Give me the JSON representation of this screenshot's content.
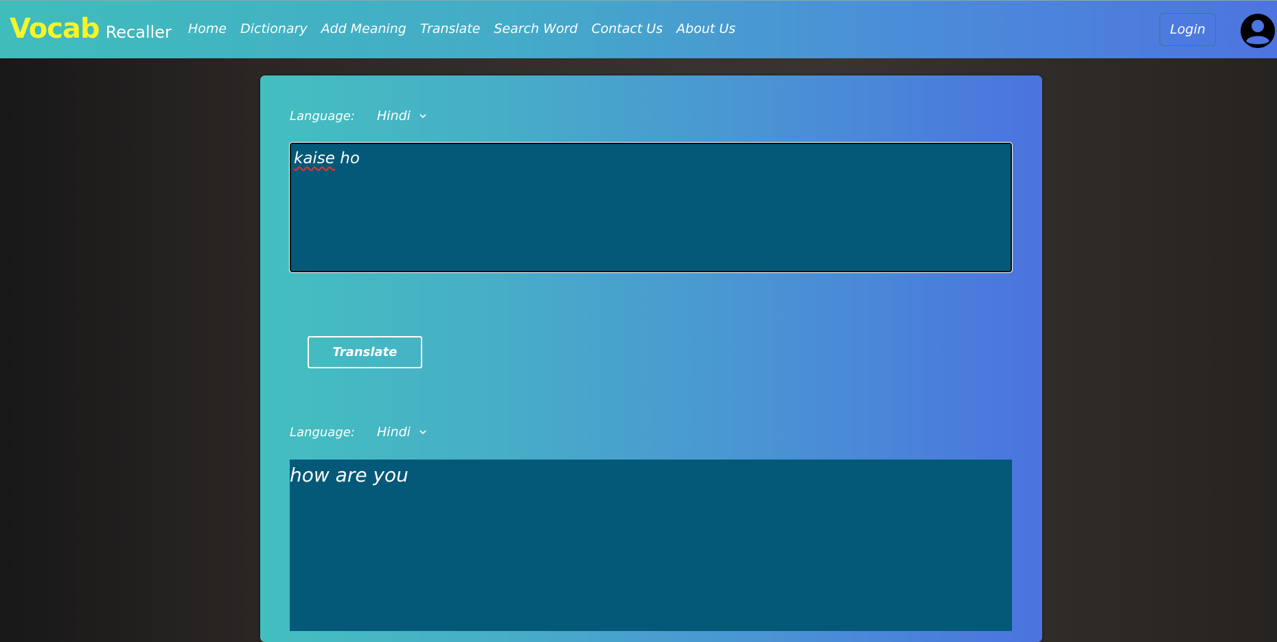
{
  "brand": {
    "main": "Vocab",
    "sub": "Recaller"
  },
  "nav": {
    "links": [
      "Home",
      "Dictionary",
      "Add Meaning",
      "Translate",
      "Search Word",
      "Contact Us",
      "About Us"
    ],
    "login": "Login",
    "avatar_icon": "user-circle-icon"
  },
  "source": {
    "language_label": "Language:",
    "language": "Hindi",
    "text_misspelled": "kaise",
    "text_rest": " ho"
  },
  "translate_button": "Translate",
  "target": {
    "language_label": "Language:",
    "language": "Hindi",
    "text": "how are you"
  },
  "colors": {
    "brand_yellow": "#f4f52a",
    "textarea_bg": "#045978",
    "nav_start": "#3fbdbb",
    "nav_end": "#4d74e0"
  }
}
